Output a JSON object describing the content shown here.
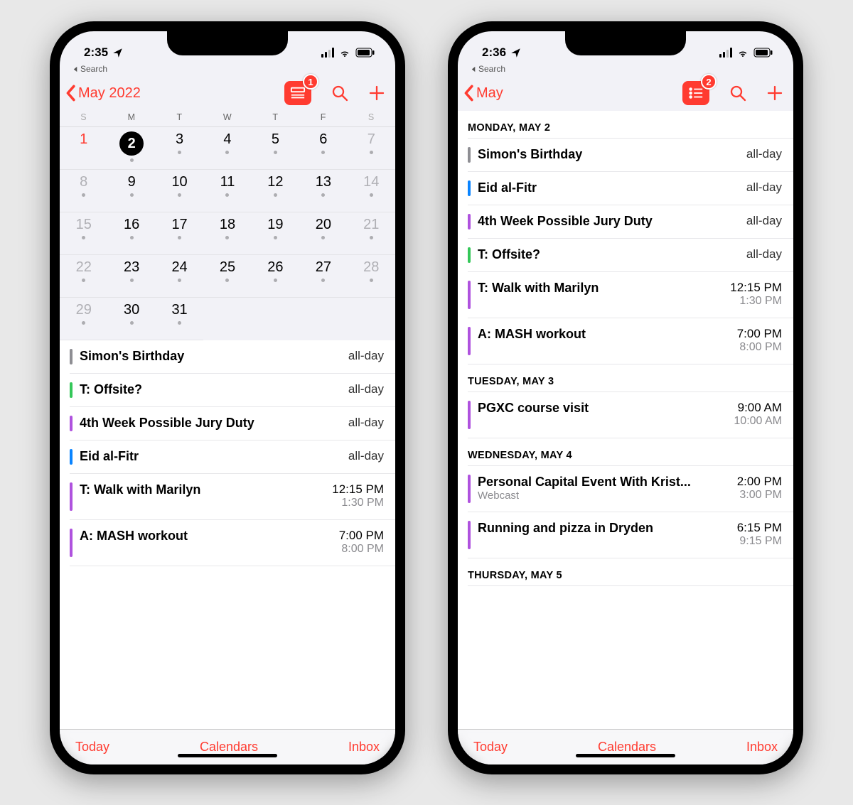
{
  "phone1": {
    "status": {
      "time": "2:35",
      "breadcrumb": "Search"
    },
    "badge": "1",
    "nav": {
      "back_label": "May 2022"
    },
    "weekdays": [
      "S",
      "M",
      "T",
      "W",
      "T",
      "F",
      "S"
    ],
    "cal_rows": [
      [
        {
          "n": "1",
          "first": true,
          "we": true,
          "dot": false
        },
        {
          "n": "2",
          "sel": true,
          "dot": true
        },
        {
          "n": "3",
          "dot": true
        },
        {
          "n": "4",
          "dot": true
        },
        {
          "n": "5",
          "dot": true
        },
        {
          "n": "6",
          "dot": true
        },
        {
          "n": "7",
          "we": true,
          "dot": true
        }
      ],
      [
        {
          "n": "8",
          "we": true,
          "dot": true
        },
        {
          "n": "9",
          "dot": true
        },
        {
          "n": "10",
          "dot": true
        },
        {
          "n": "11",
          "dot": true
        },
        {
          "n": "12",
          "dot": true
        },
        {
          "n": "13",
          "dot": true
        },
        {
          "n": "14",
          "we": true,
          "dot": true
        }
      ],
      [
        {
          "n": "15",
          "we": true,
          "dot": true
        },
        {
          "n": "16",
          "dot": true
        },
        {
          "n": "17",
          "dot": true
        },
        {
          "n": "18",
          "dot": true
        },
        {
          "n": "19",
          "dot": true
        },
        {
          "n": "20",
          "dot": true
        },
        {
          "n": "21",
          "we": true,
          "dot": true
        }
      ],
      [
        {
          "n": "22",
          "we": true,
          "dot": true
        },
        {
          "n": "23",
          "dot": true
        },
        {
          "n": "24",
          "dot": true
        },
        {
          "n": "25",
          "dot": true
        },
        {
          "n": "26",
          "dot": true
        },
        {
          "n": "27",
          "dot": true
        },
        {
          "n": "28",
          "we": true,
          "dot": true
        }
      ],
      [
        {
          "n": "29",
          "we": true,
          "dot": true
        },
        {
          "n": "30",
          "dot": true
        },
        {
          "n": "31",
          "dot": true
        },
        {
          "n": "",
          "hide": true
        },
        {
          "n": "",
          "hide": true
        },
        {
          "n": "",
          "hide": true
        },
        {
          "n": "",
          "hide": true
        }
      ]
    ],
    "events": [
      {
        "color": "#8e8e93",
        "title": "Simon's Birthday",
        "allday": "all-day"
      },
      {
        "color": "#34c759",
        "title": "T: Offsite?",
        "allday": "all-day"
      },
      {
        "color": "#af52de",
        "title": "4th Week Possible Jury Duty",
        "allday": "all-day"
      },
      {
        "color": "#0a84ff",
        "title": "Eid al-Fitr",
        "allday": "all-day"
      },
      {
        "color": "#af52de",
        "title": "T: Walk with Marilyn",
        "start": "12:15 PM",
        "end": "1:30 PM"
      },
      {
        "color": "#af52de",
        "title": "A: MASH workout",
        "start": "7:00 PM",
        "end": "8:00 PM"
      }
    ],
    "toolbar": {
      "today": "Today",
      "calendars": "Calendars",
      "inbox": "Inbox"
    }
  },
  "phone2": {
    "status": {
      "time": "2:36",
      "breadcrumb": "Search"
    },
    "badge": "2",
    "nav": {
      "back_label": "May"
    },
    "sections": [
      {
        "header": "MONDAY, MAY 2",
        "events": [
          {
            "color": "#8e8e93",
            "title": "Simon's Birthday",
            "allday": "all-day"
          },
          {
            "color": "#0a84ff",
            "title": "Eid al-Fitr",
            "allday": "all-day"
          },
          {
            "color": "#af52de",
            "title": "4th Week Possible Jury Duty",
            "allday": "all-day"
          },
          {
            "color": "#34c759",
            "title": "T: Offsite?",
            "allday": "all-day"
          },
          {
            "color": "#af52de",
            "title": "T: Walk with Marilyn",
            "start": "12:15 PM",
            "end": "1:30 PM"
          },
          {
            "color": "#af52de",
            "title": "A: MASH workout",
            "start": "7:00 PM",
            "end": "8:00 PM"
          }
        ]
      },
      {
        "header": "TUESDAY, MAY 3",
        "events": [
          {
            "color": "#af52de",
            "title": "PGXC course visit",
            "start": "9:00 AM",
            "end": "10:00 AM"
          }
        ]
      },
      {
        "header": "WEDNESDAY, MAY 4",
        "events": [
          {
            "color": "#af52de",
            "title": "Personal Capital Event With Krist...",
            "sub": "Webcast",
            "start": "2:00 PM",
            "end": "3:00 PM"
          },
          {
            "color": "#af52de",
            "title": "Running and pizza in Dryden",
            "start": "6:15 PM",
            "end": "9:15 PM"
          }
        ]
      },
      {
        "header": "THURSDAY, MAY 5",
        "events": []
      }
    ],
    "toolbar": {
      "today": "Today",
      "calendars": "Calendars",
      "inbox": "Inbox"
    }
  }
}
